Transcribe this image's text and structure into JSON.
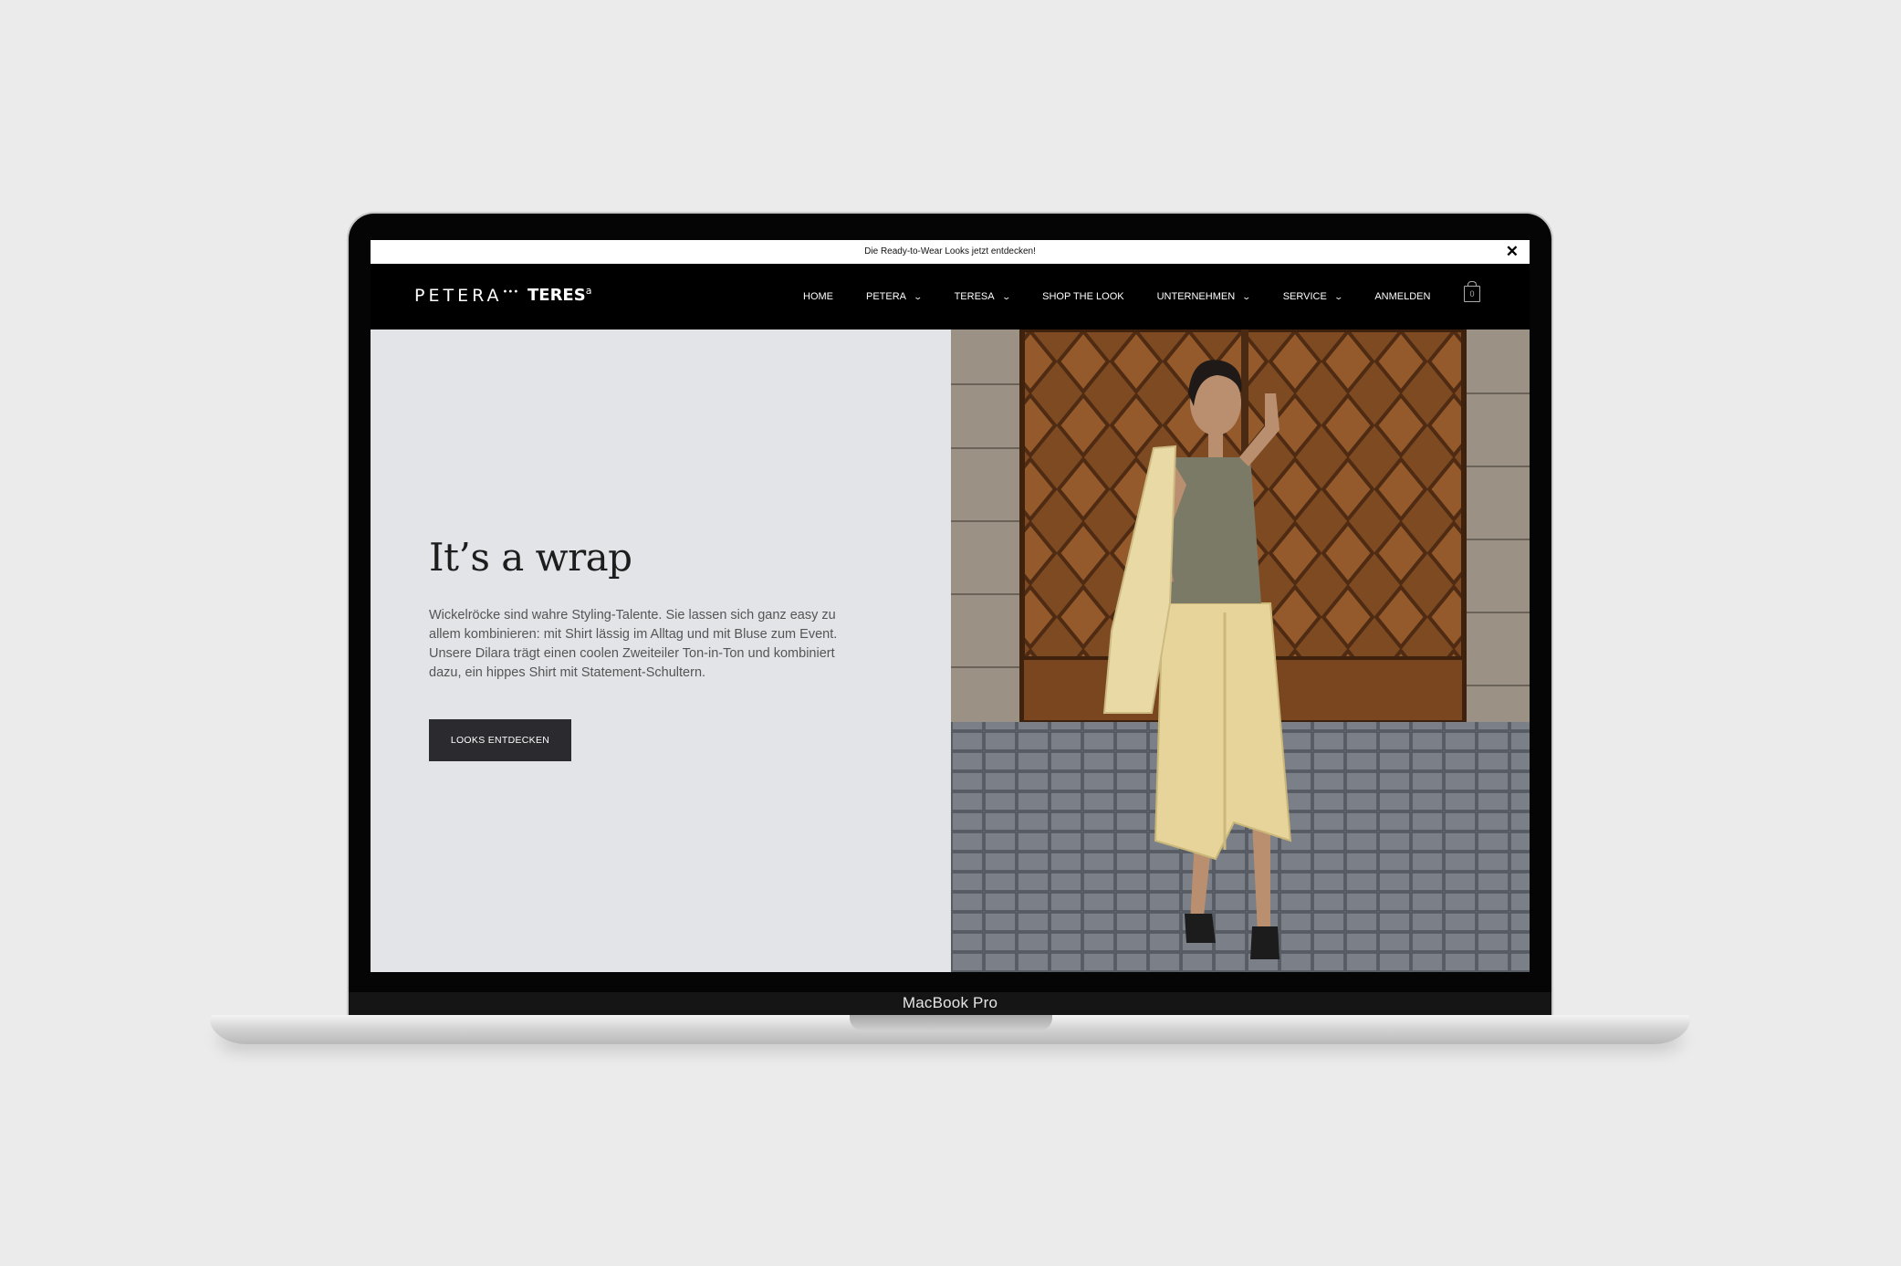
{
  "announcement": {
    "text": "Die Ready-to-Wear Looks jetzt entdecken!",
    "close": "✕"
  },
  "brand": {
    "petera": "PETERA",
    "petera_dots": "•••",
    "teresa": "TERES",
    "teresa_sup": "a"
  },
  "nav": {
    "items": [
      {
        "label": "HOME",
        "dropdown": false
      },
      {
        "label": "PETERA",
        "dropdown": true
      },
      {
        "label": "TERESA",
        "dropdown": true
      },
      {
        "label": "SHOP THE LOOK",
        "dropdown": false
      },
      {
        "label": "UNTERNEHMEN",
        "dropdown": true
      },
      {
        "label": "SERVICE",
        "dropdown": true
      },
      {
        "label": "ANMELDEN",
        "dropdown": false
      }
    ],
    "chevron": "⌄",
    "cart_count": "0"
  },
  "hero": {
    "title": "It’s a wrap",
    "text": "Wickelröcke sind wahre Styling-Talente. Sie lassen sich ganz easy zu allem kombinieren: mit Shirt lässig im Alltag und mit Bluse zum Event. Unsere Dilara trägt einen coolen Zweiteiler Ton-in-Ton und kombiniert dazu, ein hippes Shirt mit Statement-Schultern.",
    "button": "LOOKS ENTDECKEN"
  },
  "device": {
    "label": "MacBook Pro"
  },
  "colors": {
    "background": "#ebebeb",
    "nav_bg": "#000000",
    "hero_left_bg": "#e3e4e8",
    "button_bg": "#2b2b2f",
    "door": "#7a4a24",
    "skirt": "#e6d49a",
    "top": "#7b7a66",
    "pavement": "#6d727a"
  }
}
